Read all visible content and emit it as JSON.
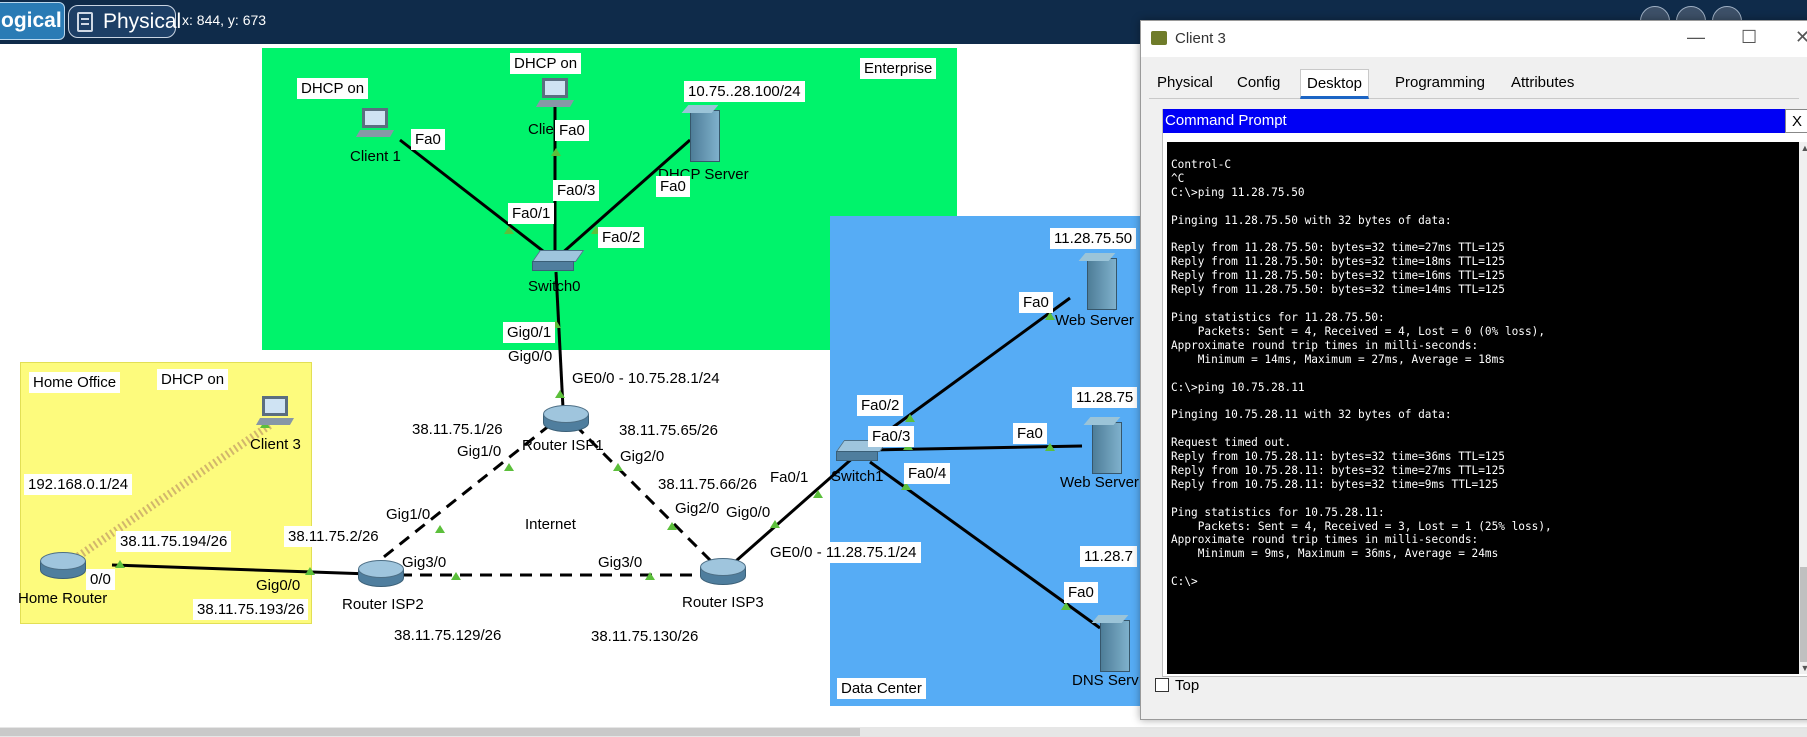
{
  "toolbar": {
    "logical_tab": "ogical",
    "physical_tab": "Physical",
    "cursor_coords": "x: 844, y: 673"
  },
  "zones": {
    "enterprise": "Enterprise",
    "home_office": "Home Office",
    "data_center": "Data Center",
    "internet": "Internet"
  },
  "devices": {
    "client1": "Client 1",
    "client2": "Clie",
    "dhcp_server": "DHCP Server",
    "switch0": "Switch0",
    "router_isp1": "Router ISP1",
    "router_isp2": "Router ISP2",
    "router_isp3": "Router ISP3",
    "home_router": "Home Router",
    "client3": "Client 3",
    "switch1": "Switch1",
    "web_server_1": "Web Server",
    "web_server_2": "Web Server",
    "dns_server": "DNS Serv"
  },
  "notes": {
    "dhcp_on_client1": "DHCP on",
    "dhcp_on_client2": "DHCP on",
    "dhcp_on_client3": "DHCP on",
    "server_ip": "10.75..28.100/24",
    "web1_ip": "11.28.75.50",
    "web2_ip": "11.28.75",
    "dns_ip": "11.28.7",
    "home_lan_ip": "192.168.0.1/24",
    "home_wan_ip": "38.11.75.194/26",
    "isp2_home_ip": "38.11.75.193/26",
    "isp2_isp1_ip": "38.11.75.2/26",
    "isp1_isp2_ip": "38.11.75.1/26",
    "isp1_isp3_ip": "38.11.75.65/26",
    "isp3_isp1_ip": "38.11.75.66/26",
    "isp2_isp3_ip": "38.11.75.129/26",
    "isp3_isp2_ip": "38.11.75.130/26",
    "isp1_ge": "GE0/0 - 10.75.28.1/24",
    "isp3_ge": "GE0/0 - 11.28.75.1/24"
  },
  "ports": {
    "c1_fa0": "Fa0",
    "c2_fa0": "Fa0",
    "srv_fa0": "Fa0",
    "sw0_fa01": "Fa0/1",
    "sw0_fa03": "Fa0/3",
    "sw0_fa02": "Fa0/2",
    "sw0_gig01": "Gig0/1",
    "isp1_gig00": "Gig0/0",
    "isp1_gig10": "Gig1/0",
    "isp1_gig20": "Gig2/0",
    "isp2_gig10": "Gig1/0",
    "isp2_gig30": "Gig3/0",
    "isp2_gig00": "Gig0/0",
    "isp3_gig30": "Gig3/0",
    "isp3_gig20": "Gig2/0",
    "isp3_gig00": "Gig0/0",
    "home_00": "0/0",
    "sw1_fa01": "Fa0/1",
    "sw1_fa02": "Fa0/2",
    "sw1_fa03": "Fa0/3",
    "sw1_fa04": "Fa0/4",
    "web1_fa0": "Fa0",
    "web2_fa0": "Fa0",
    "dns_fa0": "Fa0"
  },
  "window": {
    "title": "Client 3",
    "minimize": "—",
    "maximize": "☐",
    "close": "✕",
    "tabs": [
      "Physical",
      "Config",
      "Desktop",
      "Programming",
      "Attributes"
    ],
    "active_tab": "Desktop",
    "panel_title": "Command Prompt",
    "panel_close": "X",
    "terminal_text": "Control-C\n^C\nC:\\>ping 11.28.75.50\n\nPinging 11.28.75.50 with 32 bytes of data:\n\nReply from 11.28.75.50: bytes=32 time=27ms TTL=125\nReply from 11.28.75.50: bytes=32 time=18ms TTL=125\nReply from 11.28.75.50: bytes=32 time=16ms TTL=125\nReply from 11.28.75.50: bytes=32 time=14ms TTL=125\n\nPing statistics for 11.28.75.50:\n    Packets: Sent = 4, Received = 4, Lost = 0 (0% loss),\nApproximate round trip times in milli-seconds:\n    Minimum = 14ms, Maximum = 27ms, Average = 18ms\n\nC:\\>ping 10.75.28.11\n\nPinging 10.75.28.11 with 32 bytes of data:\n\nRequest timed out.\nReply from 10.75.28.11: bytes=32 time=36ms TTL=125\nReply from 10.75.28.11: bytes=32 time=27ms TTL=125\nReply from 10.75.28.11: bytes=32 time=9ms TTL=125\n\nPing statistics for 10.75.28.11:\n    Packets: Sent = 4, Received = 3, Lost = 1 (25% loss),\nApproximate round trip times in milli-seconds:\n    Minimum = 9ms, Maximum = 36ms, Average = 24ms\n\nC:\\>",
    "top_checkbox_label": "Top"
  },
  "colors": {
    "enterprise_bg": "#00f36b",
    "datacenter_bg": "#56acf5",
    "home_bg": "#fdfb7d",
    "toolbar_bg": "#0f2b4a",
    "link_green": "#5cbf3b",
    "command_prompt_bar": "#0000f5"
  }
}
